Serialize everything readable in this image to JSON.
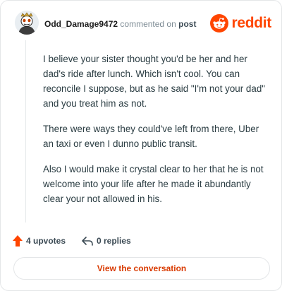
{
  "header": {
    "username": "Odd_Damage9472",
    "action_text": "commented on",
    "post_link": "post",
    "logo_text": "reddit"
  },
  "comment": {
    "paragraphs": [
      "I believe your sister thought you'd be her and her dad's ride after lunch. Which isn't cool. You can reconcile I suppose, but as he said \"I'm not your dad\" and you treat him as not.",
      "There were ways they could've left from there, Uber an taxi or even I dunno public transit.",
      "Also I would make it crystal clear to her that he is not welcome into your life after he made it abundantly clear your not allowed in his."
    ]
  },
  "actions": {
    "upvotes": "4 upvotes",
    "replies": "0 replies"
  },
  "footer": {
    "button_label": "View the conversation"
  },
  "colors": {
    "brand": "#ff4500",
    "button_text": "#d93a00"
  },
  "icons": [
    "avatar",
    "reddit-logo-icon",
    "upvote-icon",
    "reply-icon"
  ]
}
